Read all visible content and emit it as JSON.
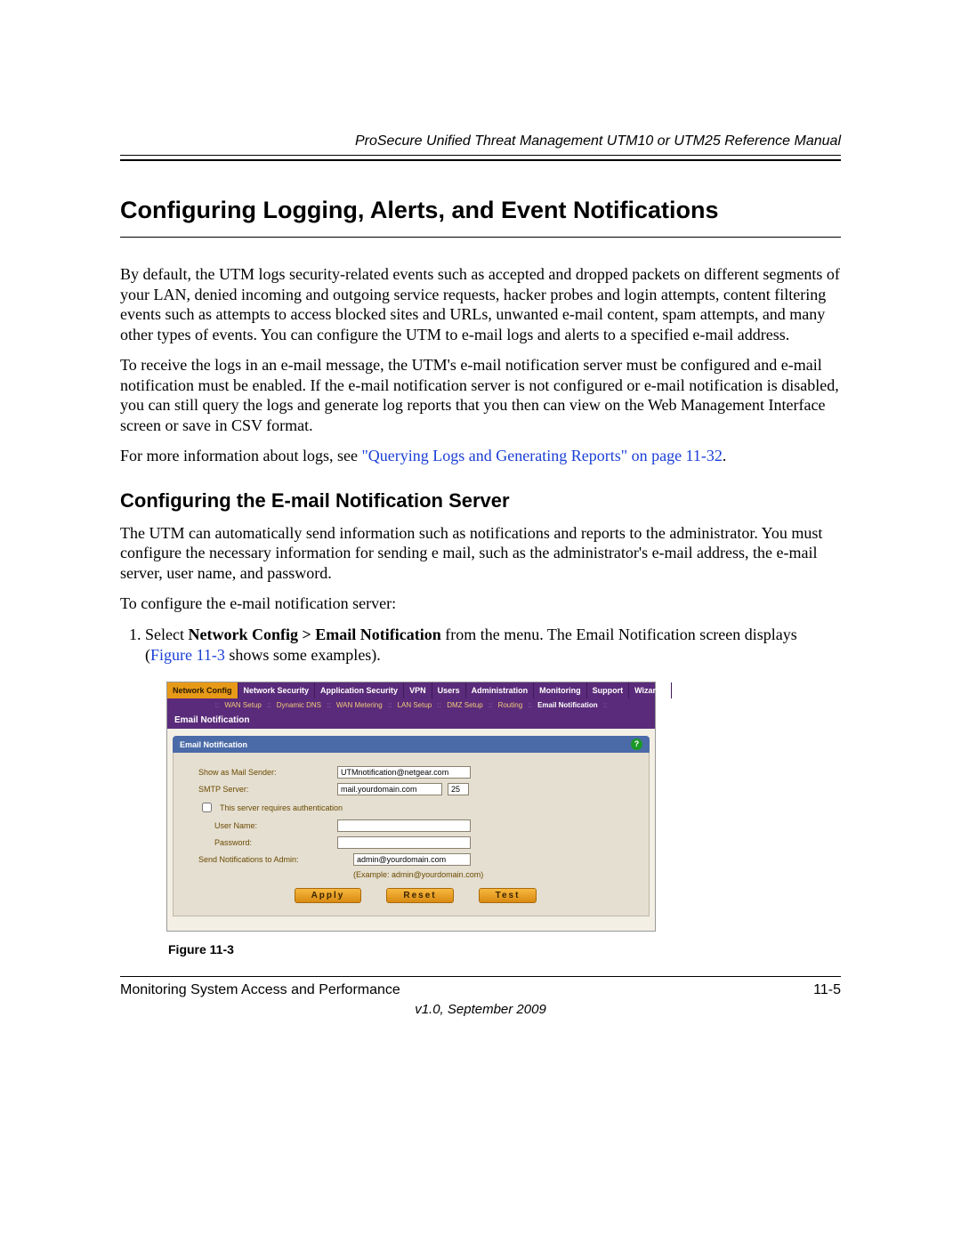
{
  "header": {
    "running_head": "ProSecure Unified Threat Management UTM10 or UTM25 Reference Manual"
  },
  "h1": "Configuring Logging, Alerts, and Event Notifications",
  "para1": "By default, the UTM logs security-related events such as accepted and dropped packets on different segments of your LAN, denied incoming and outgoing service requests, hacker probes and login attempts, content filtering events such as attempts to access blocked sites and URLs, unwanted e-mail content, spam attempts, and many other types of events. You can configure the UTM to e-mail logs and alerts to a specified e-mail address.",
  "para2": "To receive the logs in an e-mail message, the UTM's e-mail notification server must be configured and e-mail notification must be enabled. If the e-mail notification server is not configured or e-mail notification is disabled, you can still query the logs and generate log reports that you then can view on the Web Management Interface screen or save in CSV format.",
  "para3_pre": "For more information about logs, see ",
  "para3_link": "\"Querying Logs and Generating Reports\" on page 11-32",
  "para3_post": ".",
  "h2": "Configuring the E-mail Notification Server",
  "para4": "The UTM can automatically send information such as notifications and reports to the administrator. You must configure the necessary information for sending e mail, such as the administrator's e-mail address, the e-mail server, user name, and password.",
  "para5": "To configure the e-mail notification server:",
  "step1_num": "1.",
  "step1_a": "Select ",
  "step1_bold": "Network Config > Email Notification",
  "step1_b": " from the menu. The Email Notification screen displays (",
  "step1_link": "Figure 11-3",
  "step1_c": " shows some examples).",
  "ui": {
    "tabs": [
      "Network Config",
      "Network Security",
      "Application Security",
      "VPN",
      "Users",
      "Administration",
      "Monitoring",
      "Support",
      "Wizards"
    ],
    "subnav": [
      "WAN Setup",
      "Dynamic DNS",
      "WAN Metering",
      "LAN Setup",
      "DMZ Setup",
      "Routing",
      "Email Notification"
    ],
    "breadcrumb": "Email Notification",
    "panel_title": "Email Notification",
    "labels": {
      "sender": "Show as Mail Sender:",
      "smtp": "SMTP Server:",
      "auth": "This server requires authentication",
      "user": "User Name:",
      "pass": "Password:",
      "admin": "Send Notifications to Admin:",
      "example": "(Example: admin@yourdomain.com)"
    },
    "values": {
      "sender": "UTMnotification@netgear.com",
      "smtp_host": "mail.yourdomain.com",
      "smtp_port": "25",
      "user": "",
      "pass": "",
      "admin": "admin@yourdomain.com"
    },
    "buttons": {
      "apply": "Apply",
      "reset": "Reset",
      "test": "Test"
    },
    "help": "?"
  },
  "fig_caption": "Figure 11-3",
  "footer": {
    "left": "Monitoring System Access and Performance",
    "right": "11-5",
    "version": "v1.0, September 2009"
  }
}
